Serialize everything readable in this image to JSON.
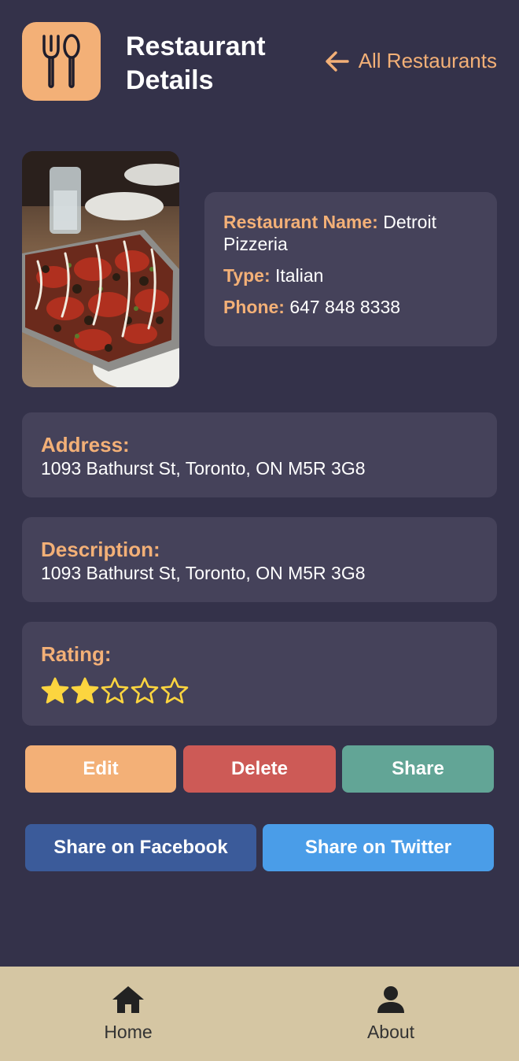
{
  "header": {
    "title": "Restaurant Details",
    "back_label": "All Restaurants"
  },
  "restaurant": {
    "name_label": "Restaurant Name:",
    "name": "Detroit Pizzeria",
    "type_label": "Type:",
    "type": "Italian",
    "phone_label": "Phone:",
    "phone": "647 848 8338",
    "address_label": "Address:",
    "address": "1093 Bathurst St, Toronto, ON M5R 3G8",
    "description_label": "Description:",
    "description": "1093 Bathurst St, Toronto, ON M5R 3G8",
    "rating_label": "Rating:",
    "rating": 2,
    "rating_max": 5
  },
  "actions": {
    "edit": "Edit",
    "delete": "Delete",
    "share": "Share",
    "share_facebook": "Share on Facebook",
    "share_twitter": "Share on Twitter"
  },
  "tabbar": {
    "home": "Home",
    "about": "About"
  },
  "colors": {
    "background": "#34324a",
    "card": "#45425a",
    "accent": "#f3b077",
    "delete": "#cd5a56",
    "share": "#62a596",
    "facebook": "#3b5b9a",
    "twitter": "#4a9de8",
    "tabbar": "#d5c6a3",
    "star": "#fcd53f"
  },
  "icons": {
    "logo": "fork-spoon-icon",
    "back": "arrow-left-icon",
    "home": "home-icon",
    "about": "person-icon",
    "star_filled": "star-filled-icon",
    "star_empty": "star-outline-icon"
  }
}
